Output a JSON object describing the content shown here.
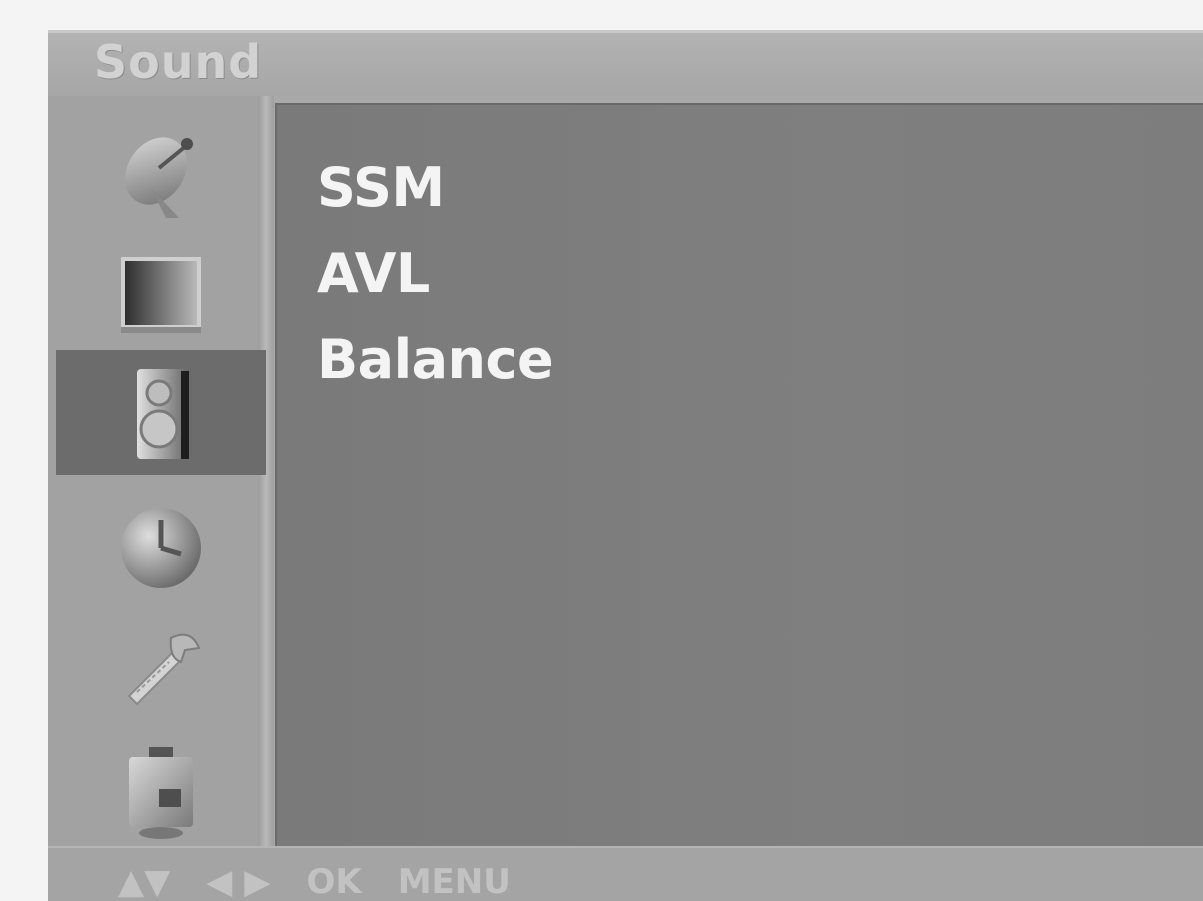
{
  "menu": {
    "title": "Sound",
    "sidebar": [
      {
        "icon": "satellite-dish-icon",
        "label": "Station"
      },
      {
        "icon": "picture-icon",
        "label": "Picture"
      },
      {
        "icon": "speaker-icon",
        "label": "Sound"
      },
      {
        "icon": "clock-icon",
        "label": "Time"
      },
      {
        "icon": "wrench-icon",
        "label": "Special"
      },
      {
        "icon": "screen-icon",
        "label": "Screen"
      }
    ],
    "selected_index": 2,
    "options": [
      "SSM",
      "AVL",
      "Balance"
    ],
    "footer_hints": [
      "▲▼",
      "◀ ▶",
      "OK",
      "MENU"
    ]
  },
  "colors": {
    "background": "#f4f4f4",
    "frame": "#a9a9a9",
    "content": "#7d7d7d",
    "selected": "#6c6c6c",
    "text": "#f4f4f4"
  }
}
